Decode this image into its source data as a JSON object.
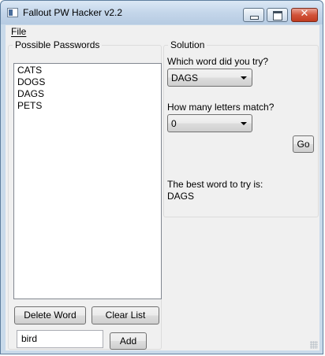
{
  "window": {
    "title": "Fallout PW Hacker v2.2",
    "close_glyph": "✕"
  },
  "menu": {
    "file": "File"
  },
  "possible_passwords": {
    "label": "Possible Passwords",
    "items": [
      "CATS",
      "DOGS",
      "DAGS",
      "PETS"
    ],
    "delete_button": "Delete Word",
    "clear_button": "Clear List",
    "input_value": "bird",
    "add_button": "Add"
  },
  "solution": {
    "label": "Solution",
    "word_question": "Which word did you try?",
    "word_selected": "DAGS",
    "match_question": "How many letters match?",
    "match_selected": "0",
    "go_button": "Go",
    "best_word_label": "The best word to try is:",
    "best_word_value": "DAGS"
  },
  "icons": {
    "app": "app-window-icon",
    "dropdown": "chevron-down-icon"
  }
}
